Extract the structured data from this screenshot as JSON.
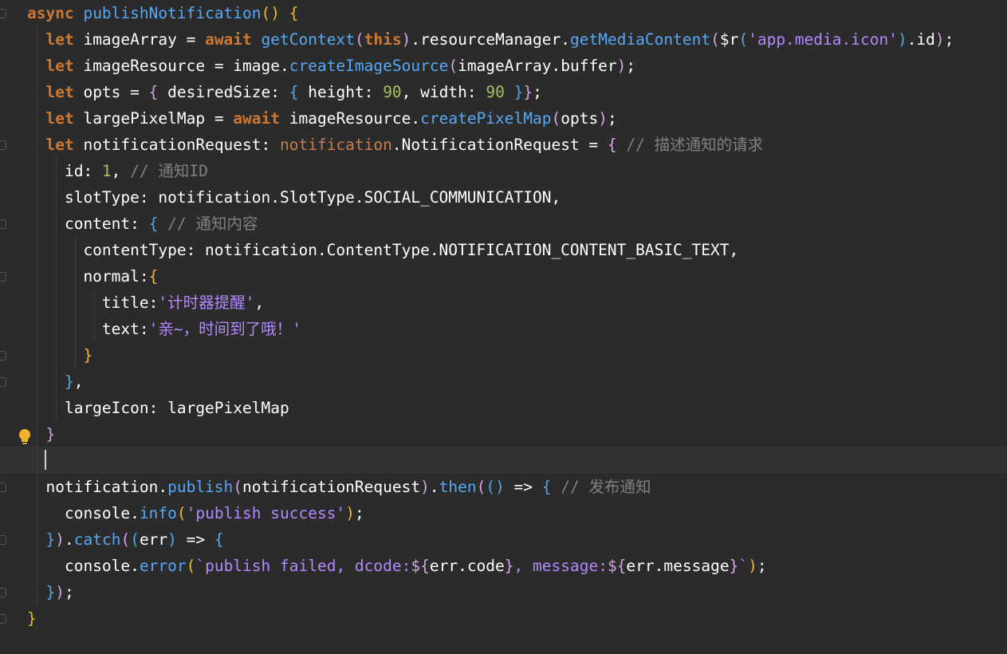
{
  "editor": {
    "lines": [
      [
        [
          "kw",
          "async "
        ],
        [
          "fn",
          "publishNotification"
        ],
        [
          "br1",
          "() {"
        ]
      ],
      [
        [
          "id",
          "  "
        ],
        [
          "kw",
          "let "
        ],
        [
          "id",
          "imageArray = "
        ],
        [
          "kw",
          "await "
        ],
        [
          "fn",
          "getContext"
        ],
        [
          "br2",
          "("
        ],
        [
          "kw",
          "this"
        ],
        [
          "br2",
          ")"
        ],
        [
          "id",
          ".resourceManager."
        ],
        [
          "fn",
          "getMediaContent"
        ],
        [
          "br2",
          "("
        ],
        [
          "id",
          "$r"
        ],
        [
          "br3",
          "("
        ],
        [
          "str",
          "'app.media.icon'"
        ],
        [
          "br3",
          ")"
        ],
        [
          "id",
          ".id"
        ],
        [
          "br2",
          ")"
        ],
        [
          "id",
          ";"
        ]
      ],
      [
        [
          "id",
          "  "
        ],
        [
          "kw",
          "let "
        ],
        [
          "id",
          "imageResource = image."
        ],
        [
          "fn",
          "createImageSource"
        ],
        [
          "br2",
          "("
        ],
        [
          "id",
          "imageArray.buffer"
        ],
        [
          "br2",
          ")"
        ],
        [
          "id",
          ";"
        ]
      ],
      [
        [
          "id",
          "  "
        ],
        [
          "kw",
          "let "
        ],
        [
          "id",
          "opts = "
        ],
        [
          "br2",
          "{"
        ],
        [
          "id",
          " desiredSize: "
        ],
        [
          "br3",
          "{"
        ],
        [
          "id",
          " height: "
        ],
        [
          "num",
          "90"
        ],
        [
          "id",
          ", width: "
        ],
        [
          "num",
          "90"
        ],
        [
          "id",
          " "
        ],
        [
          "br3",
          "}"
        ],
        [
          "br2",
          "}"
        ],
        [
          "id",
          ";"
        ]
      ],
      [
        [
          "id",
          "  "
        ],
        [
          "kw",
          "let "
        ],
        [
          "id",
          "largePixelMap = "
        ],
        [
          "kw",
          "await "
        ],
        [
          "id",
          "imageResource."
        ],
        [
          "fn",
          "createPixelMap"
        ],
        [
          "br2",
          "("
        ],
        [
          "id",
          "opts"
        ],
        [
          "br2",
          ")"
        ],
        [
          "id",
          ";"
        ]
      ],
      [
        [
          "id",
          "  "
        ],
        [
          "kw",
          "let "
        ],
        [
          "id",
          "notificationRequest: "
        ],
        [
          "ns",
          "notification"
        ],
        [
          "id",
          ".NotificationRequest = "
        ],
        [
          "br2",
          "{"
        ],
        [
          "cm",
          " // 描述通知的请求"
        ]
      ],
      [
        [
          "id",
          "    id: "
        ],
        [
          "num",
          "1"
        ],
        [
          "id",
          ","
        ],
        [
          "cm",
          " // 通知ID"
        ]
      ],
      [
        [
          "id",
          "    slotType: notification.SlotType.SOCIAL_COMMUNICATION,"
        ]
      ],
      [
        [
          "id",
          "    content: "
        ],
        [
          "br3",
          "{"
        ],
        [
          "cm",
          " // 通知内容"
        ]
      ],
      [
        [
          "id",
          "      contentType: notification.ContentType.NOTIFICATION_CONTENT_BASIC_TEXT,"
        ]
      ],
      [
        [
          "id",
          "      normal:"
        ],
        [
          "br1",
          "{"
        ]
      ],
      [
        [
          "id",
          "        title:"
        ],
        [
          "str",
          "'计时器提醒'"
        ],
        [
          "id",
          ","
        ]
      ],
      [
        [
          "id",
          "        text:"
        ],
        [
          "str",
          "'亲~，时间到了哦！'"
        ]
      ],
      [
        [
          "id",
          "      "
        ],
        [
          "br1",
          "}"
        ]
      ],
      [
        [
          "id",
          "    "
        ],
        [
          "br3",
          "}"
        ],
        [
          "id",
          ","
        ]
      ],
      [
        [
          "id",
          "    largeIcon: largePixelMap"
        ]
      ],
      [
        [
          "id",
          "  "
        ],
        [
          "br2",
          "}"
        ]
      ],
      [
        [
          "id",
          ""
        ]
      ],
      [
        [
          "id",
          "  notification."
        ],
        [
          "fn",
          "publish"
        ],
        [
          "br2",
          "("
        ],
        [
          "id",
          "notificationRequest"
        ],
        [
          "br2",
          ")"
        ],
        [
          "id",
          "."
        ],
        [
          "fn",
          "then"
        ],
        [
          "br2",
          "("
        ],
        [
          "br3",
          "()"
        ],
        [
          "id",
          " => "
        ],
        [
          "br3",
          "{"
        ],
        [
          "cm",
          " // 发布通知"
        ]
      ],
      [
        [
          "id",
          "    console."
        ],
        [
          "fn",
          "info"
        ],
        [
          "br1",
          "("
        ],
        [
          "str",
          "'publish success'"
        ],
        [
          "br1",
          ")"
        ],
        [
          "id",
          ";"
        ]
      ],
      [
        [
          "id",
          "  "
        ],
        [
          "br3",
          "}"
        ],
        [
          "br2",
          ")"
        ],
        [
          "id",
          "."
        ],
        [
          "fn",
          "catch"
        ],
        [
          "br2",
          "("
        ],
        [
          "br3",
          "("
        ],
        [
          "id",
          "err"
        ],
        [
          "br3",
          ")"
        ],
        [
          "id",
          " => "
        ],
        [
          "br3",
          "{"
        ]
      ],
      [
        [
          "id",
          "    console."
        ],
        [
          "fn",
          "error"
        ],
        [
          "br1",
          "("
        ],
        [
          "tpl",
          "`publish failed, dcode:"
        ],
        [
          "br2",
          "${"
        ],
        [
          "id",
          "err.code"
        ],
        [
          "br2",
          "}"
        ],
        [
          "tpl",
          ", message:"
        ],
        [
          "br2",
          "${"
        ],
        [
          "id",
          "err.message"
        ],
        [
          "br2",
          "}"
        ],
        [
          "tpl",
          "`"
        ],
        [
          "br1",
          ")"
        ],
        [
          "id",
          ";"
        ]
      ],
      [
        [
          "id",
          "  "
        ],
        [
          "br3",
          "}"
        ],
        [
          "br2",
          ")"
        ],
        [
          "id",
          ";"
        ]
      ],
      [
        [
          "br1",
          "}"
        ]
      ]
    ]
  }
}
